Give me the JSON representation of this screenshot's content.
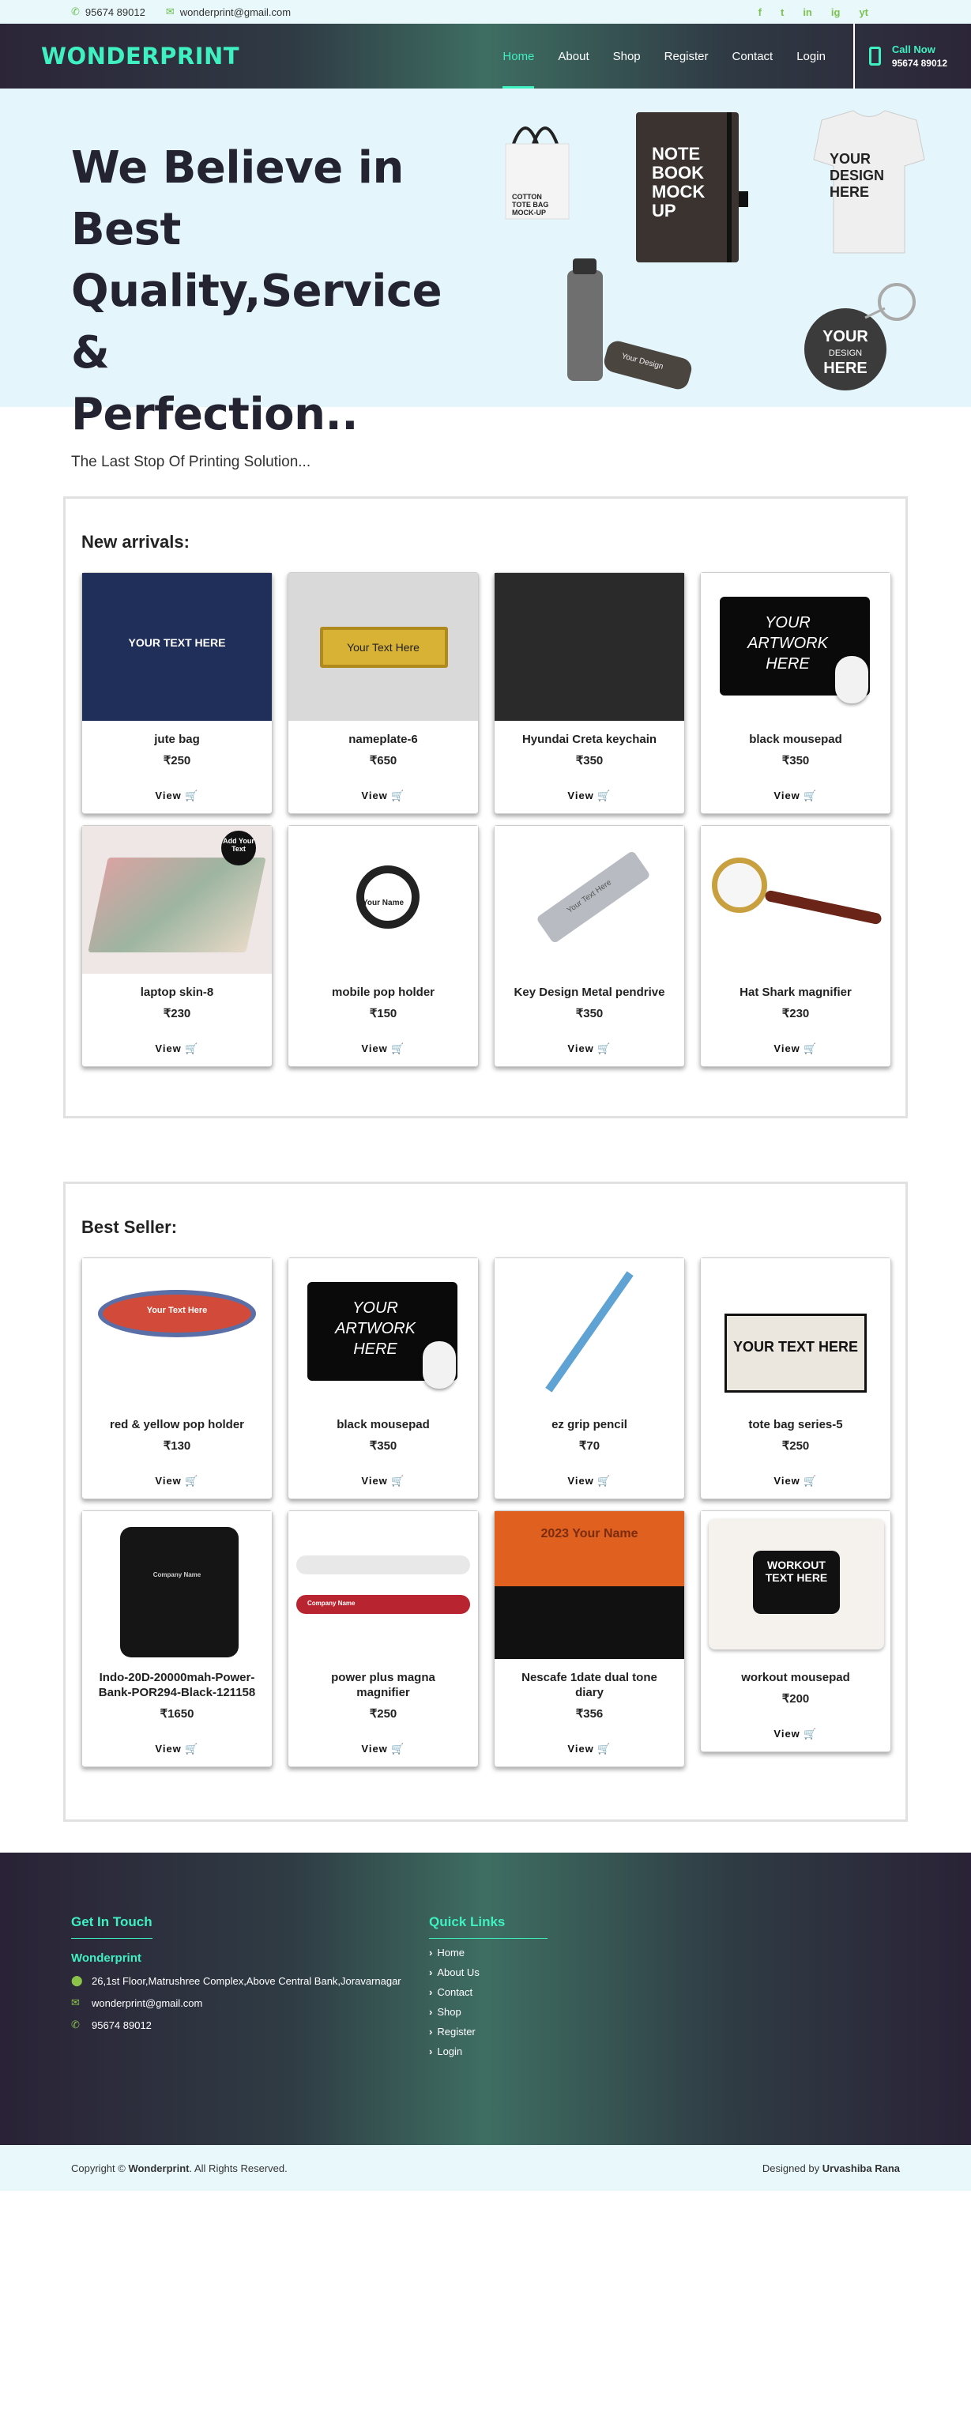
{
  "topbar": {
    "phone": "95674 89012",
    "email": "wonderprint@gmail.com",
    "socials": [
      "f",
      "t",
      "in",
      "ig",
      "yt"
    ]
  },
  "nav": {
    "brand": "WONDERPRINT",
    "links": [
      "Home",
      "About",
      "Shop",
      "Register",
      "Contact",
      "Login"
    ],
    "active": "Home",
    "call_title": "Call Now",
    "call_number": "95674 89012"
  },
  "hero": {
    "title_line1": "We Believe in Best",
    "title_line2": "Quality,Service &",
    "title_line3": "Perfection..",
    "subtitle": "The Last Stop Of Printing Solution...",
    "mockups": {
      "tote": "COTTON TOTE BAG MOCK-UP",
      "notebook_1": "NOTE",
      "notebook_2": "BOOK",
      "notebook_3": "MOCK",
      "notebook_4": "UP",
      "tshirt_1": "YOUR",
      "tshirt_2": "DESIGN",
      "tshirt_3": "HERE",
      "bottle": "Your Design",
      "keychain_1": "YOUR",
      "keychain_2": "DESIGN",
      "keychain_3": "HERE"
    }
  },
  "new_arrivals": {
    "title": "New arrivals:",
    "view_label": "View",
    "items": [
      {
        "name": "jute bag",
        "price": "₹250",
        "art": "YOUR TEXT HERE"
      },
      {
        "name": "nameplate-6",
        "price": "₹650",
        "art": "Your Text Here"
      },
      {
        "name": "Hyundai Creta keychain",
        "price": "₹350",
        "art": ""
      },
      {
        "name": "black mousepad",
        "price": "₹350",
        "art": "YOUR ARTWORK HERE"
      },
      {
        "name": "laptop skin-8",
        "price": "₹230",
        "art": "Add Your Text"
      },
      {
        "name": "mobile pop holder",
        "price": "₹150",
        "art": "Your Name"
      },
      {
        "name": "Key Design Metal pendrive",
        "price": "₹350",
        "art": "Your Text Here"
      },
      {
        "name": "Hat Shark magnifier",
        "price": "₹230",
        "art": ""
      }
    ]
  },
  "best_seller": {
    "title": "Best Seller:",
    "view_label": "View",
    "items": [
      {
        "name": "red & yellow pop holder",
        "price": "₹130",
        "art": "Your Text Here"
      },
      {
        "name": "black mousepad",
        "price": "₹350",
        "art": "YOUR ARTWORK HERE"
      },
      {
        "name": "ez grip pencil",
        "price": "₹70",
        "art": ""
      },
      {
        "name": "tote bag series-5",
        "price": "₹250",
        "art": "YOUR TEXT HERE"
      },
      {
        "name": "Indo-20D-20000mah-Power-Bank-POR294-Black-121158",
        "price": "₹1650",
        "art": "Company Name"
      },
      {
        "name": "power plus magna magnifier",
        "price": "₹250",
        "art": "Company Name"
      },
      {
        "name": "Nescafe 1date dual tone diary",
        "price": "₹356",
        "art": "2023 Your Name"
      },
      {
        "name": "workout mousepad",
        "price": "₹200",
        "art": "WORKOUT TEXT HERE"
      }
    ]
  },
  "footer": {
    "touch_title": "Get In Touch",
    "company": "Wonderprint",
    "address": "26,1st Floor,Matrushree Complex,Above Central Bank,Joravarnagar",
    "email": "wonderprint@gmail.com",
    "phone": "95674 89012",
    "links_title": "Quick Links",
    "links": [
      "Home",
      "About Us",
      "Contact",
      "Shop",
      "Register",
      "Login"
    ]
  },
  "copyright": {
    "prefix": "Copyright ©",
    "brand": "Wonderprint",
    "suffix": ". All Rights Reserved.",
    "designed_prefix": "Designed by",
    "designer": "Urvashiba Rana"
  },
  "colors": {
    "accent": "#3ff0c0",
    "green_icon": "#7cc34f",
    "hero_bg": "#e4f6fb",
    "nav_dark": "#2c2538"
  }
}
